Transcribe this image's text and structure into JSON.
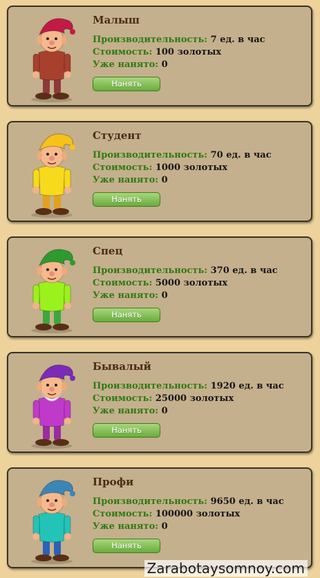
{
  "workers": [
    {
      "name": "Малыш",
      "prod_label": "Производительность:",
      "prod_value": "7 ед. в час",
      "cost_label": "Стоимость:",
      "cost_value": "100 золотых",
      "hired_label": "Уже нанято:",
      "hired_value": "0",
      "button": "Нанять",
      "hat_color": "#c21a46",
      "shirt_color": "#a8402e",
      "pants_color": "#8b3a3a",
      "beard": false
    },
    {
      "name": "Студент",
      "prod_label": "Производительность:",
      "prod_value": "70 ед. в час",
      "cost_label": "Стоимость:",
      "cost_value": "1000 золотых",
      "hired_label": "Уже нанято:",
      "hired_value": "0",
      "button": "Нанять",
      "hat_color": "#f6c21a",
      "shirt_color": "#f7da1c",
      "pants_color": "#e3a21c",
      "beard": false
    },
    {
      "name": "Спец",
      "prod_label": "Производительность:",
      "prod_value": "370 ед. в час",
      "cost_label": "Стоимость:",
      "cost_value": "5000 золотых",
      "hired_label": "Уже нанято:",
      "hired_value": "0",
      "button": "Нанять",
      "hat_color": "#2e9a2f",
      "shirt_color": "#9bf11c",
      "pants_color": "#3ca83b",
      "beard": false
    },
    {
      "name": "Бывалый",
      "prod_label": "Производительность:",
      "prod_value": "1920 ед. в час",
      "cost_label": "Стоимость:",
      "cost_value": "25000 золотых",
      "hired_label": "Уже нанято:",
      "hired_value": "0",
      "button": "Нанять",
      "hat_color": "#7b2bb8",
      "shirt_color": "#c03ac9",
      "pants_color": "#9a2ca0",
      "beard": true
    },
    {
      "name": "Профи",
      "prod_label": "Производительность:",
      "prod_value": "9650 ед. в час",
      "cost_label": "Стоимость:",
      "cost_value": "100000 золотых",
      "hired_label": "Уже нанято:",
      "hired_value": "0",
      "button": "Нанять",
      "hat_color": "#3b86b8",
      "shirt_color": "#24c3b7",
      "pants_color": "#2b62b8",
      "beard": false
    }
  ],
  "watermark": "Zarabotaysomnoy.com"
}
